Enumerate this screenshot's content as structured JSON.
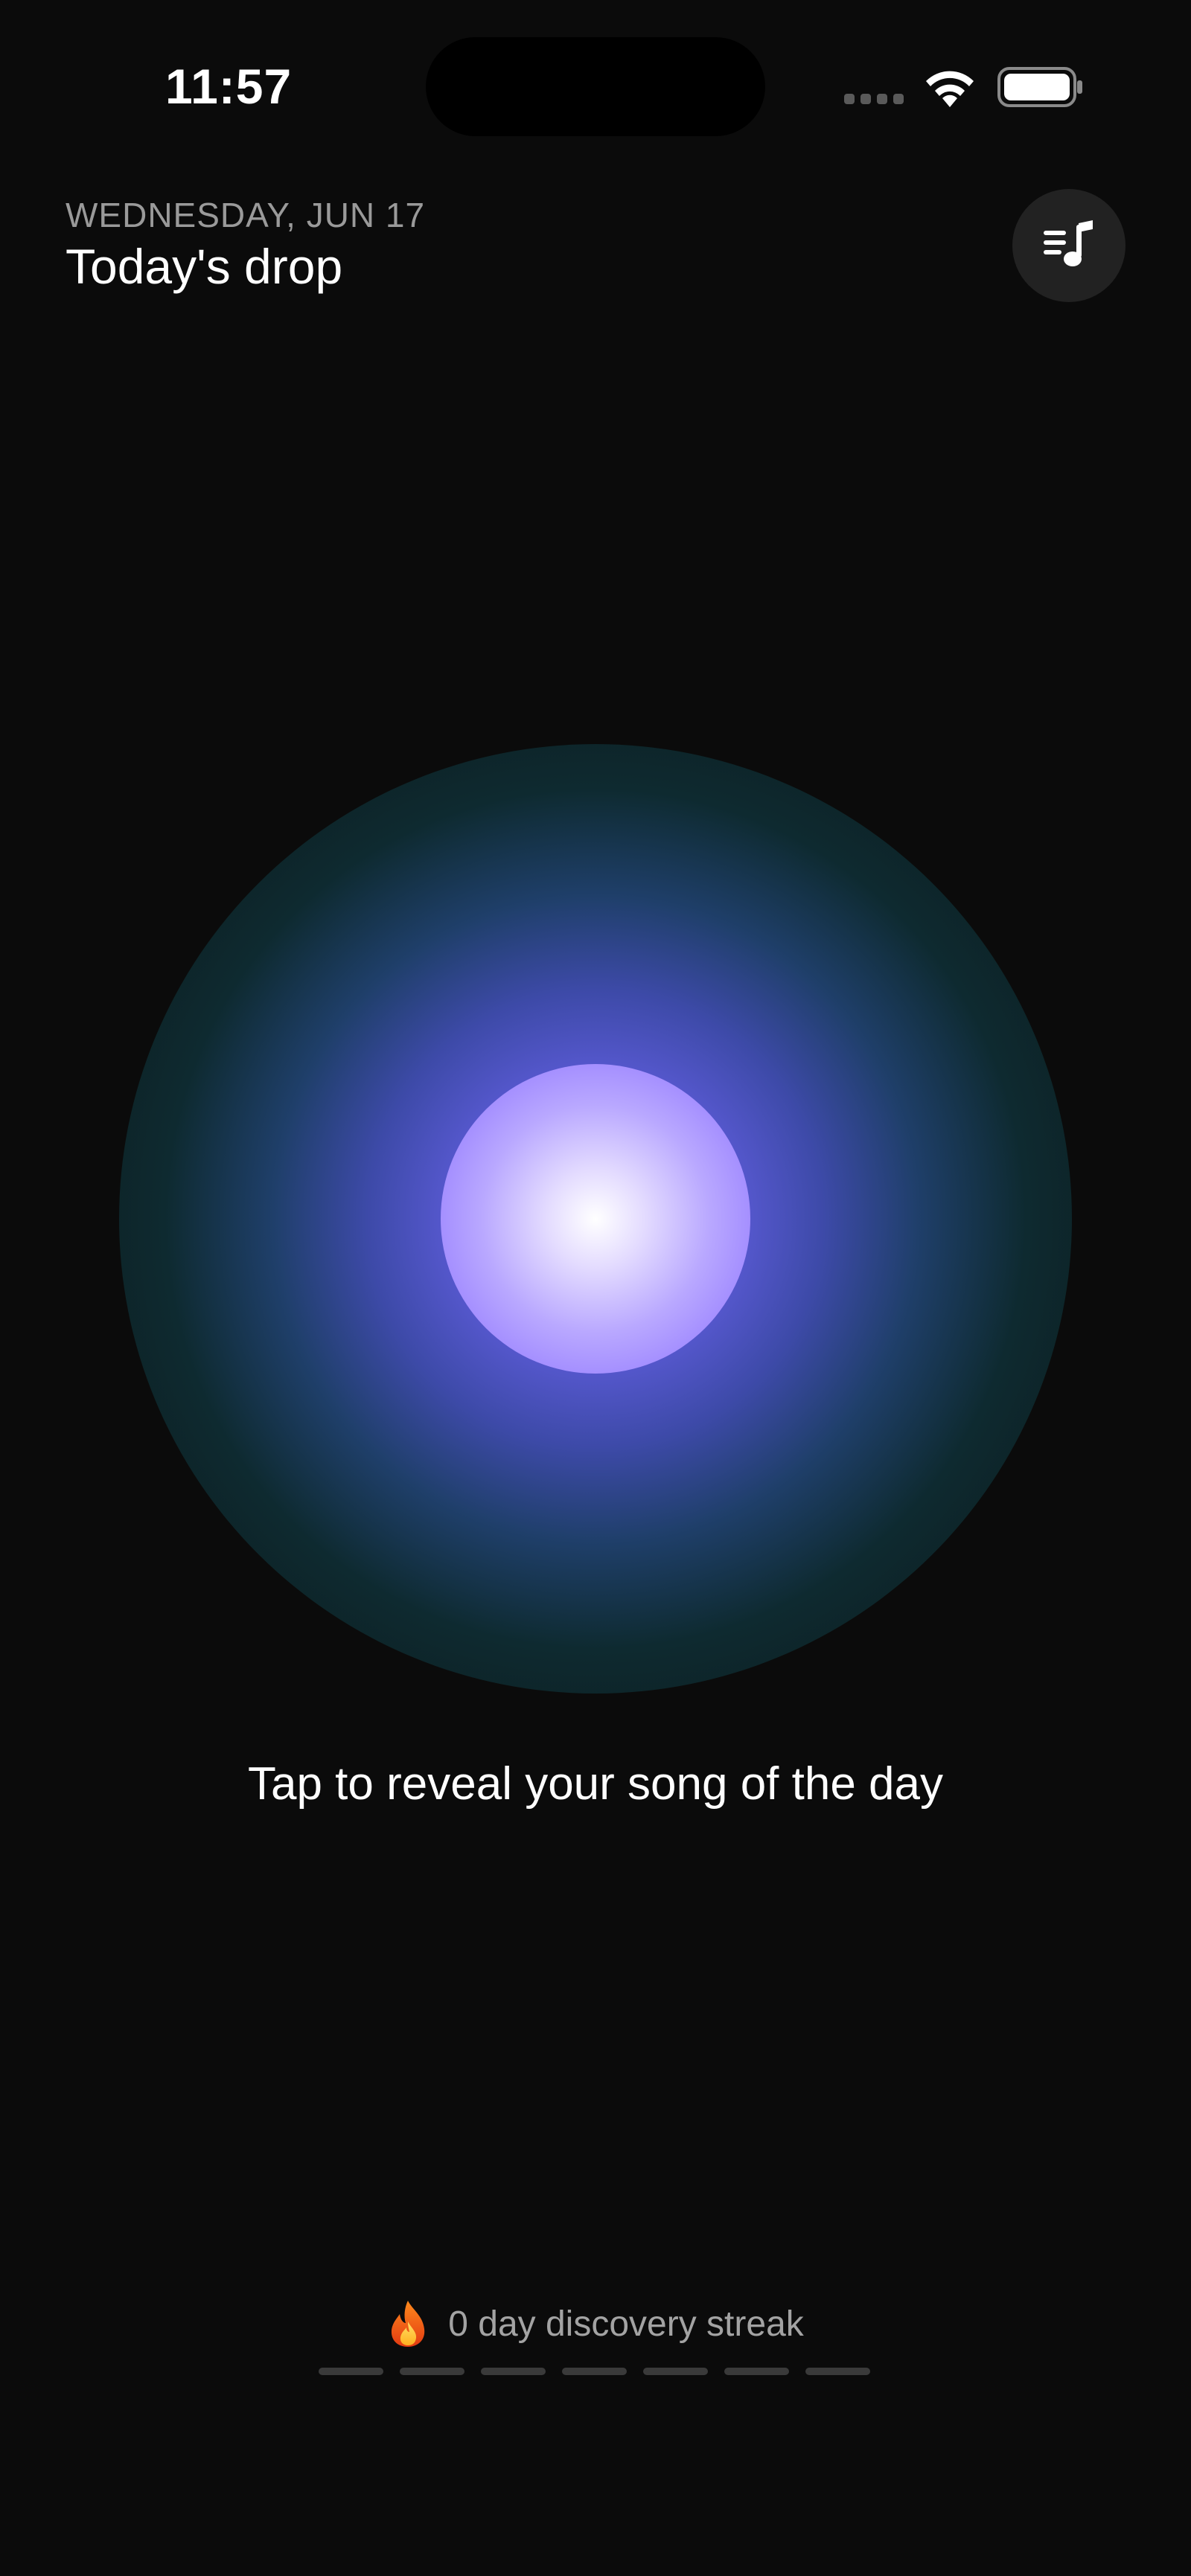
{
  "status_bar": {
    "time": "11:57",
    "icons": [
      "cellular-signal-icon",
      "wifi-icon",
      "battery-icon"
    ]
  },
  "header": {
    "date": "WEDNESDAY, JUN 17",
    "title": "Today's drop",
    "queue_button_icon": "music-queue-icon"
  },
  "orb": {
    "prompt": "Tap to reveal your song of the day",
    "colors": {
      "core": "#ffffff",
      "inner": "#9d86ff",
      "mid": "#5a5ad4",
      "outer": "#0e2a30"
    }
  },
  "streak": {
    "icon": "fire-icon",
    "text": "0 day discovery streak",
    "days_total": 7,
    "days_completed": 0
  },
  "colors": {
    "background": "#0b0b0b",
    "secondary_text": "#9a9a9a",
    "button_bg": "#222222"
  }
}
